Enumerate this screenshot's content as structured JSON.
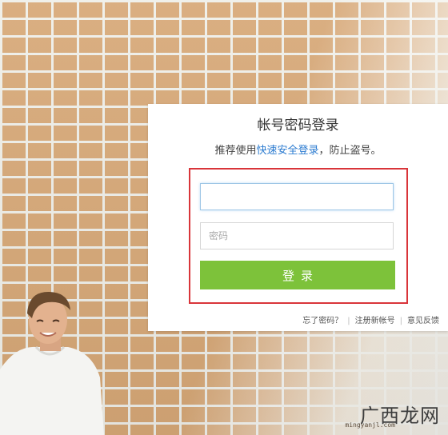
{
  "login": {
    "title": "帐号密码登录",
    "subtitle_prefix": "推荐使用",
    "subtitle_link": "快速安全登录",
    "subtitle_suffix": "，防止盗号。",
    "username_placeholder": "",
    "password_placeholder": "密码",
    "submit_label": "登录",
    "links": {
      "forgot": "忘了密码？",
      "register": "注册新帐号",
      "feedback": "意见反馈",
      "separator": "|"
    }
  },
  "watermark": {
    "logo": "广西龙网",
    "url": "mingyanjl.com"
  },
  "colors": {
    "button": "#7dc23a",
    "link": "#2b7bd0",
    "highlight_border": "#d9353a"
  }
}
